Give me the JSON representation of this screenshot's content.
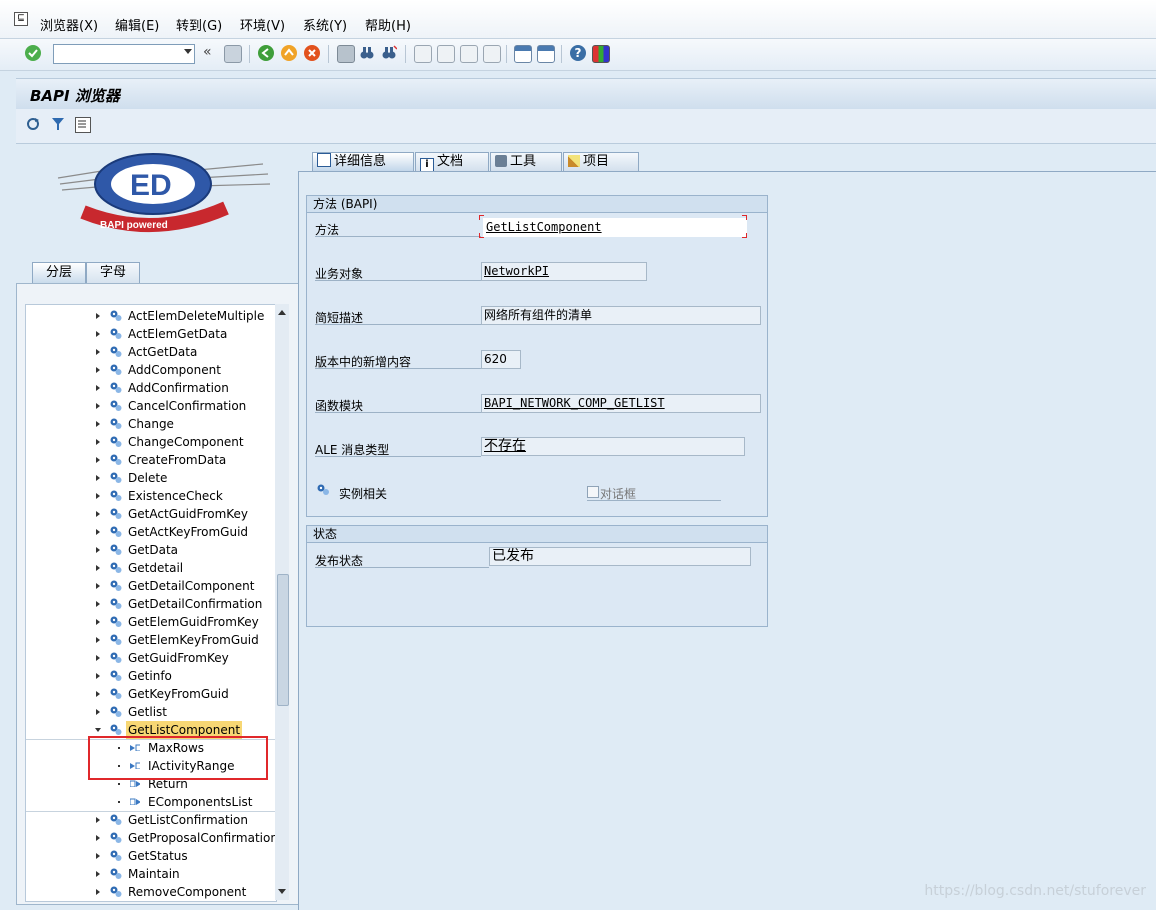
{
  "menubar": {
    "items": [
      "浏览器(X)",
      "编辑(E)",
      "转到(G)",
      "环境(V)",
      "系统(Y)",
      "帮助(H)"
    ]
  },
  "toolbar": {
    "command_value": "",
    "icons": [
      "enter-icon",
      "back-nav-icon",
      "save-icon",
      "back-icon",
      "exit-icon",
      "cancel-icon",
      "print-icon",
      "find-icon",
      "find-next-icon",
      "first-page-icon",
      "prev-page-icon",
      "next-page-icon",
      "last-page-icon",
      "new-session-icon",
      "shortcut-icon",
      "help-icon",
      "customize-layout-icon"
    ]
  },
  "title": "BAPI 浏览器",
  "appbar": {
    "icons": [
      "refresh-icon",
      "filter-icon",
      "list-icon"
    ]
  },
  "logo": {
    "text": "BAPI powered"
  },
  "left_tabs": [
    "分层",
    "字母"
  ],
  "tree": {
    "items": [
      {
        "label": "ActElemDeleteMultiple",
        "type": "method"
      },
      {
        "label": "ActElemGetData",
        "type": "method"
      },
      {
        "label": "ActGetData",
        "type": "method"
      },
      {
        "label": "AddComponent",
        "type": "method"
      },
      {
        "label": "AddConfirmation",
        "type": "method"
      },
      {
        "label": "CancelConfirmation",
        "type": "method"
      },
      {
        "label": "Change",
        "type": "method"
      },
      {
        "label": "ChangeComponent",
        "type": "method"
      },
      {
        "label": "CreateFromData",
        "type": "method"
      },
      {
        "label": "Delete",
        "type": "method"
      },
      {
        "label": "ExistenceCheck",
        "type": "method"
      },
      {
        "label": "GetActGuidFromKey",
        "type": "method"
      },
      {
        "label": "GetActKeyFromGuid",
        "type": "method"
      },
      {
        "label": "GetData",
        "type": "method"
      },
      {
        "label": "Getdetail",
        "type": "method"
      },
      {
        "label": "GetDetailComponent",
        "type": "method"
      },
      {
        "label": "GetDetailConfirmation",
        "type": "method"
      },
      {
        "label": "GetElemGuidFromKey",
        "type": "method"
      },
      {
        "label": "GetElemKeyFromGuid",
        "type": "method"
      },
      {
        "label": "GetGuidFromKey",
        "type": "method"
      },
      {
        "label": "Getinfo",
        "type": "method"
      },
      {
        "label": "GetKeyFromGuid",
        "type": "method"
      },
      {
        "label": "Getlist",
        "type": "method"
      },
      {
        "label": "GetListComponent",
        "type": "method",
        "selected": true,
        "expanded": true
      },
      {
        "label": "MaxRows",
        "type": "param"
      },
      {
        "label": "IActivityRange",
        "type": "param"
      },
      {
        "label": "Return",
        "type": "param-out"
      },
      {
        "label": "EComponentsList",
        "type": "param-out"
      },
      {
        "label": "GetListConfirmation",
        "type": "method"
      },
      {
        "label": "GetProposalConfirmation",
        "type": "method"
      },
      {
        "label": "GetStatus",
        "type": "method"
      },
      {
        "label": "Maintain",
        "type": "method"
      },
      {
        "label": "RemoveComponent",
        "type": "method"
      }
    ]
  },
  "right_tabs": [
    {
      "label": "详细信息",
      "icon": "detail-icon"
    },
    {
      "label": "文档",
      "icon": "info-icon"
    },
    {
      "label": "工具",
      "icon": "tools-icon"
    },
    {
      "label": "项目",
      "icon": "wand-icon"
    }
  ],
  "bapi_group": {
    "title": "方法 (BAPI)",
    "fields": [
      {
        "label": "方法",
        "value": "GetListComponent"
      },
      {
        "label": "业务对象",
        "value": "NetworkPI"
      },
      {
        "label": "简短描述",
        "value": "网络所有组件的清单"
      },
      {
        "label": "版本中的新增内容",
        "value": "620"
      },
      {
        "label": "函数模块",
        "value": "BAPI_NETWORK_COMP_GETLIST"
      },
      {
        "label": "ALE 消息类型",
        "value": "不存在"
      }
    ],
    "instance_label": "实例相关",
    "dialog_label": "对话框",
    "dialog_checked": false
  },
  "status_group": {
    "title": "状态",
    "label": "发布状态",
    "value": "已发布"
  },
  "watermark": "https://blog.csdn.net/stuforever"
}
